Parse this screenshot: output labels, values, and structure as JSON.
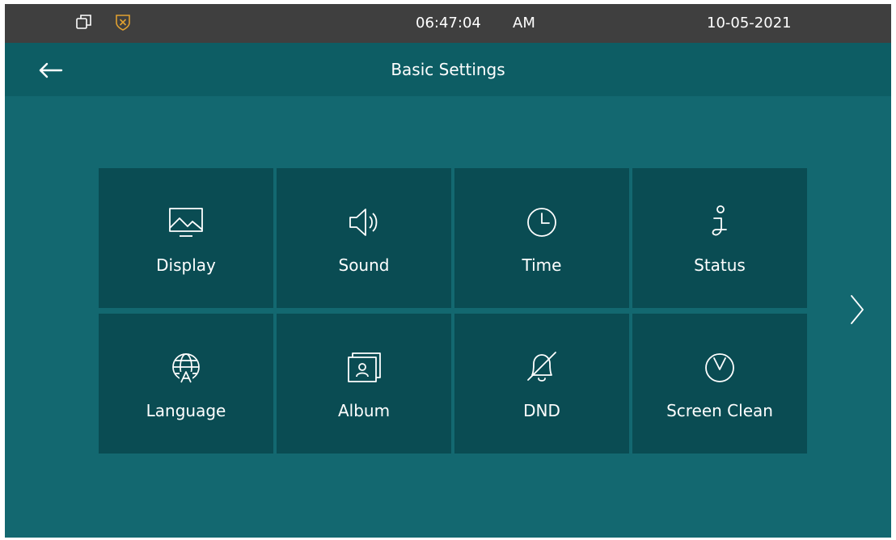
{
  "status_bar": {
    "time": "06:47:04",
    "ampm": "AM",
    "date": "10-05-2021",
    "icons": [
      "window-restore-icon",
      "shield-icon"
    ]
  },
  "header": {
    "title": "Basic Settings",
    "back_icon": "back-arrow-icon"
  },
  "tiles": [
    {
      "label": "Display",
      "icon": "display-icon"
    },
    {
      "label": "Sound",
      "icon": "speaker-icon"
    },
    {
      "label": "Time",
      "icon": "clock-icon"
    },
    {
      "label": "Status",
      "icon": "info-icon"
    },
    {
      "label": "Language",
      "icon": "globe-icon"
    },
    {
      "label": "Album",
      "icon": "album-icon"
    },
    {
      "label": "DND",
      "icon": "bell-off-icon"
    },
    {
      "label": "Screen Clean",
      "icon": "timer-icon"
    }
  ],
  "nav": {
    "next_icon": "chevron-right-icon"
  },
  "colors": {
    "background": "#136870",
    "status_bar": "#3f3f3f",
    "header": "#0d5d64",
    "tile": "#0a4c53",
    "shield_accent": "#e0a030",
    "text": "#ffffff"
  }
}
